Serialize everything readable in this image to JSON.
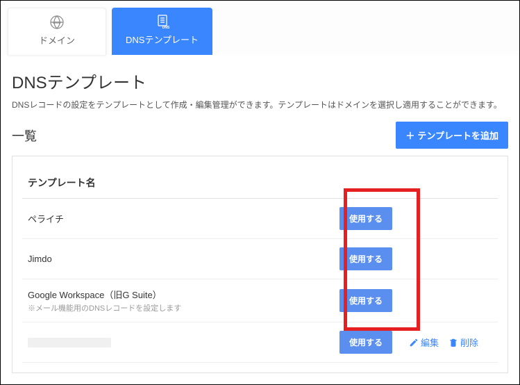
{
  "tabs": {
    "domain": {
      "label": "ドメイン",
      "iconText": "www"
    },
    "dns": {
      "label": "DNSテンプレート",
      "iconText": "DNS"
    }
  },
  "page": {
    "title": "DNSテンプレート",
    "description": "DNSレコードの設定をテンプレートとして作成・編集管理ができます。テンプレートはドメインを選択し適用することができます。"
  },
  "section": {
    "listHeading": "一覧",
    "addButton": "テンプレートを追加",
    "columnHeader": "テンプレート名"
  },
  "buttons": {
    "use": "使用する",
    "edit": "編集",
    "delete": "削除"
  },
  "templates": [
    {
      "name": "ペライチ",
      "subnote": ""
    },
    {
      "name": "Jimdo",
      "subnote": ""
    },
    {
      "name": "Google Workspace（旧G Suite）",
      "subnote": "※メール機能用のDNSレコードを設定します"
    },
    {
      "name": "",
      "subnote": "",
      "blurred": true,
      "hasActions": true
    }
  ],
  "colors": {
    "primary": "#3a86ff",
    "highlight": "#e62020"
  }
}
